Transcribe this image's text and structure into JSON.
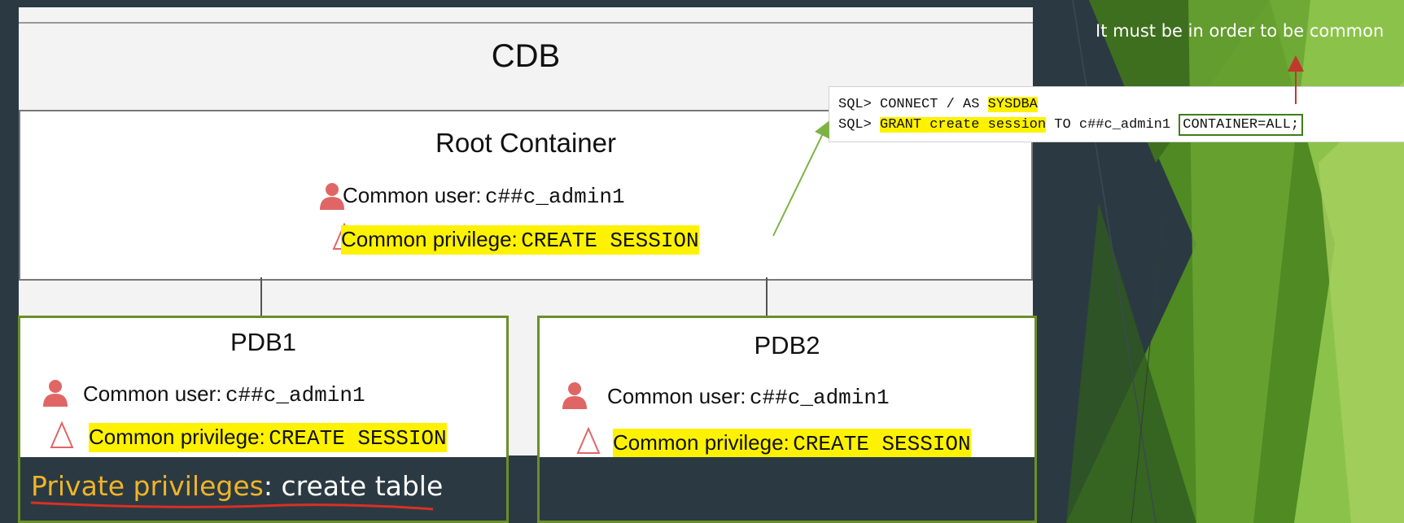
{
  "cdb": {
    "title": "CDB"
  },
  "root": {
    "title": "Root Container",
    "user_label": "Common user:",
    "user_value": "c##c_admin1",
    "priv_label": "Common privilege:",
    "priv_value": "CREATE SESSION"
  },
  "pdbs": [
    {
      "title": "PDB1",
      "user_label": "Common user:",
      "user_value": "c##c_admin1",
      "priv_label": "Common privilege:",
      "priv_value": "CREATE SESSION"
    },
    {
      "title": "PDB2",
      "user_label": "Common user:",
      "user_value": "c##c_admin1",
      "priv_label": "Common privilege:",
      "priv_value": "CREATE SESSION"
    }
  ],
  "private": {
    "label": "Private privileges",
    "separator": ":",
    "value": " create table"
  },
  "sql": {
    "line1_prompt": "SQL> CONNECT / AS ",
    "line1_role": "SYSDBA",
    "line2_prompt": "SQL> ",
    "line2_grant": "GRANT create session",
    "line2_rest": " TO c##c_admin1 ",
    "line2_container": "CONTAINER=ALL;"
  },
  "note": "It must be in order to be common",
  "colors": {
    "highlight": "#fff200",
    "box_border": "#6a8f2a",
    "accent_green": "#7cb342",
    "arrow_red": "#c0392b",
    "private_gold": "#f0b429",
    "icon_red": "#e06666"
  },
  "icons": {
    "user": "person-icon",
    "privilege": "triangle-icon"
  }
}
